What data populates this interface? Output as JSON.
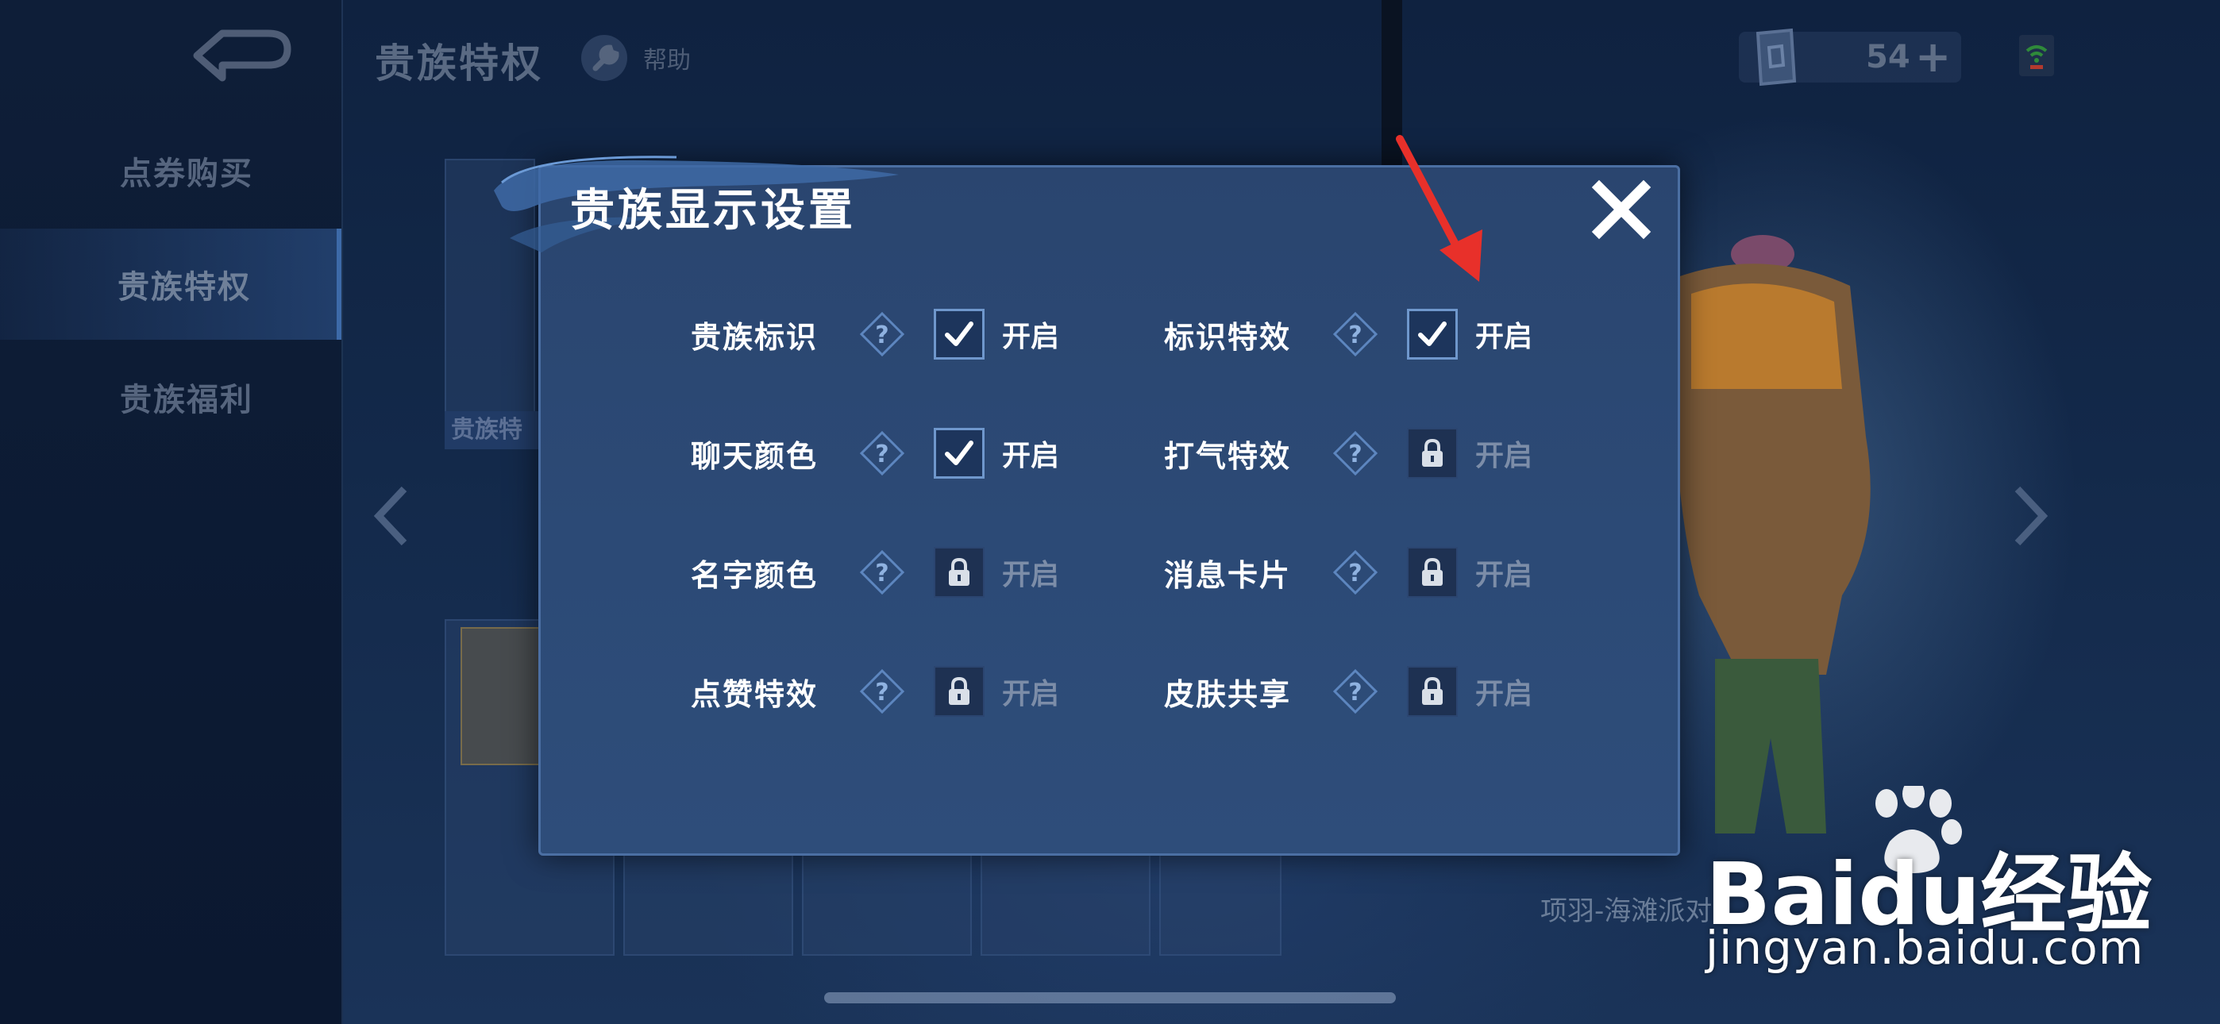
{
  "header": {
    "title": "贵族特权",
    "help_label": "帮助",
    "currency_amount": "54",
    "plus_label": "+"
  },
  "sidebar": {
    "items": [
      {
        "label": "点券购买",
        "active": false
      },
      {
        "label": "贵族特权",
        "active": true
      },
      {
        "label": "贵族福利",
        "active": false
      }
    ]
  },
  "background": {
    "tag_label": "贵族特",
    "hero_name": "项羽-海滩派对"
  },
  "dialog": {
    "title": "贵族显示设置",
    "options": [
      {
        "label": "贵族标识",
        "state_label": "开启",
        "status": "checked"
      },
      {
        "label": "标识特效",
        "state_label": "开启",
        "status": "checked"
      },
      {
        "label": "聊天颜色",
        "state_label": "开启",
        "status": "checked"
      },
      {
        "label": "打气特效",
        "state_label": "开启",
        "status": "locked"
      },
      {
        "label": "名字颜色",
        "state_label": "开启",
        "status": "locked"
      },
      {
        "label": "消息卡片",
        "state_label": "开启",
        "status": "locked"
      },
      {
        "label": "点赞特效",
        "state_label": "开启",
        "status": "locked"
      },
      {
        "label": "皮肤共享",
        "state_label": "开启",
        "status": "locked"
      }
    ]
  },
  "watermark": {
    "brand": "Baidu经验",
    "url": "jingyan.baidu.com"
  },
  "colors": {
    "dialog_bg": "#2c4a76",
    "dialog_border": "#4b6fa3",
    "checkbox_check": "#ffffff",
    "annotation_arrow": "#e8302a"
  }
}
